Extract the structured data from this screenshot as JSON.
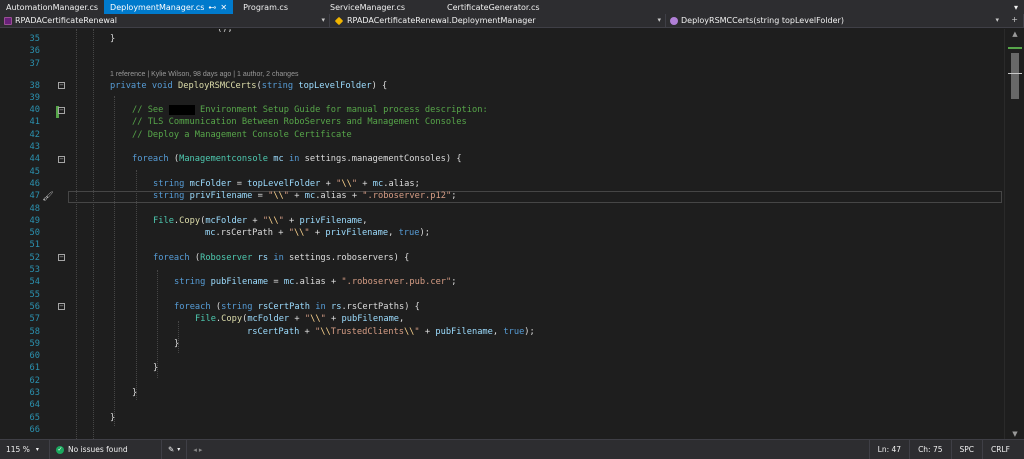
{
  "tabs": [
    {
      "label": "AutomationManager.cs",
      "active": false
    },
    {
      "label": "DeploymentManager.cs",
      "active": true
    },
    {
      "label": "Program.cs",
      "active": false
    },
    {
      "label": "ServiceManager.cs",
      "active": false
    },
    {
      "label": "CertificateGenerator.cs",
      "active": false
    }
  ],
  "tab_pin_glyph": "⊷",
  "tab_close_glyph": "✕",
  "nav": {
    "project": "RPADACertificateRenewal",
    "type": "RPADACertificateRenewal.DeploymentManager",
    "member": "DeployRSMCCerts(string topLevelFolder)"
  },
  "codelens": "1 reference | Kylie Wilson, 98 days ago | 1 author, 2 changes",
  "line_numbers": [
    "35",
    "36",
    "37",
    "38",
    "39",
    "40",
    "41",
    "42",
    "43",
    "44",
    "45",
    "46",
    "47",
    "48",
    "49",
    "50",
    "51",
    "52",
    "53",
    "54",
    "55",
    "56",
    "57",
    "58",
    "59",
    "60",
    "61",
    "62",
    "63",
    "64",
    "65",
    "66"
  ],
  "status": {
    "zoom": "115 %",
    "issues": "No issues found",
    "line": "Ln: 47",
    "col": "Ch: 75",
    "whitespace": "SPC",
    "eol": "CRLF"
  },
  "colors": {
    "accent": "#007acc",
    "keyword": "#569cd6",
    "type": "#4ec9b0",
    "string": "#d69d85",
    "comment": "#57a64a",
    "line_number": "#2b91af"
  }
}
